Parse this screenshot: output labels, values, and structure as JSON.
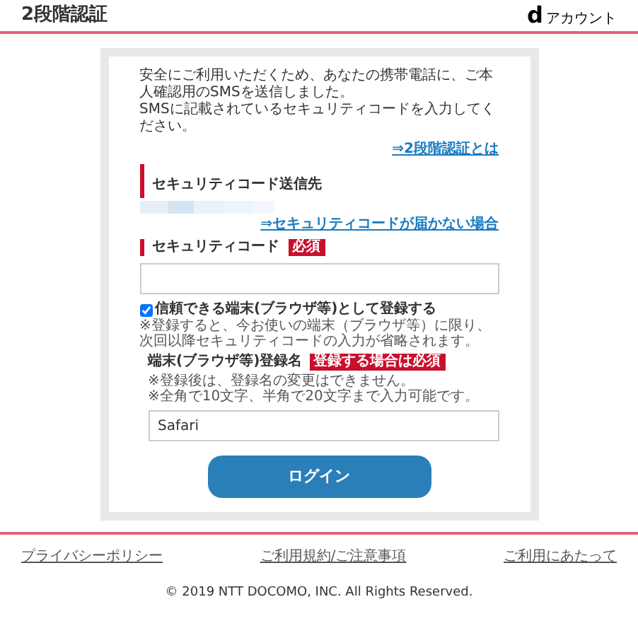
{
  "header": {
    "title": "2段階認証",
    "brand_mark": "d",
    "brand_text": "アカウント"
  },
  "intro": "安全にご利用いただくため、あなたの携帯電話に、ご本人確認用のSMSを送信しました。\nSMSに記載されているセキュリティコードを入力してください。",
  "about_link": "⇒2段階認証とは",
  "destination": {
    "heading": "セキュリティコード送信先"
  },
  "not_received_link": "⇒セキュリティコードが届かない場合",
  "code": {
    "heading": "セキュリティコード",
    "badge": "必須"
  },
  "trust": {
    "label": "信頼できる端末(ブラウザ等)として登録する",
    "checked": true,
    "note": "※登録すると、今お使いの端末（ブラウザ等）に限り、次回以降セキュリティコードの入力が省略されます。"
  },
  "device_name": {
    "heading": "端末(ブラウザ等)登録名",
    "badge": "登録する場合は必須",
    "notes": [
      "※登録後は、登録名の変更はできません。",
      "※全角で10文字、半角で20文字まで入力可能です。"
    ],
    "value": "Safari"
  },
  "login_button": "ログイン",
  "footer": {
    "links": [
      "プライバシーポリシー",
      "ご利用規約/ご注意事項",
      "ご利用にあたって"
    ],
    "copyright": "© 2019 NTT DOCOMO, INC. All Rights Reserved."
  }
}
